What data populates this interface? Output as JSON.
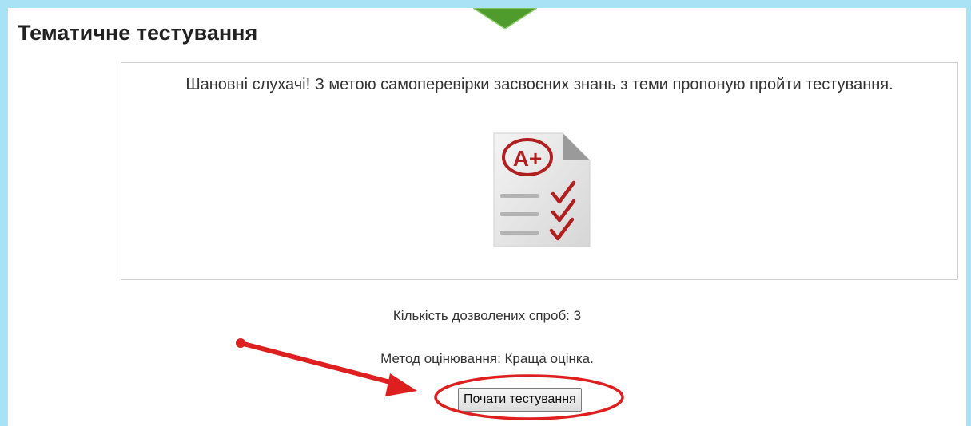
{
  "page": {
    "title": "Тематичне тестування"
  },
  "intro": {
    "text": "Шановні слухачі! З метою самоперевірки засвоєних знань з теми пропоную пройти тестування.",
    "icon_grade": "A+"
  },
  "quiz_info": {
    "attempts": "Кількість дозволених спроб: 3",
    "grading_method": "Метод оцінювання: Краща оцінка."
  },
  "actions": {
    "start_label": "Почати тестування"
  },
  "icons": {
    "test_icon": "graded-test-sheet-icon",
    "annotation_arrow": "red-arrow-annotation",
    "annotation_circle": "red-ellipse-annotation"
  },
  "colors": {
    "page_background": "#a9e2f5",
    "annotation_red": "#dd1f1f",
    "tab_green": "#4f9b2c",
    "grade_red": "#b02020"
  }
}
